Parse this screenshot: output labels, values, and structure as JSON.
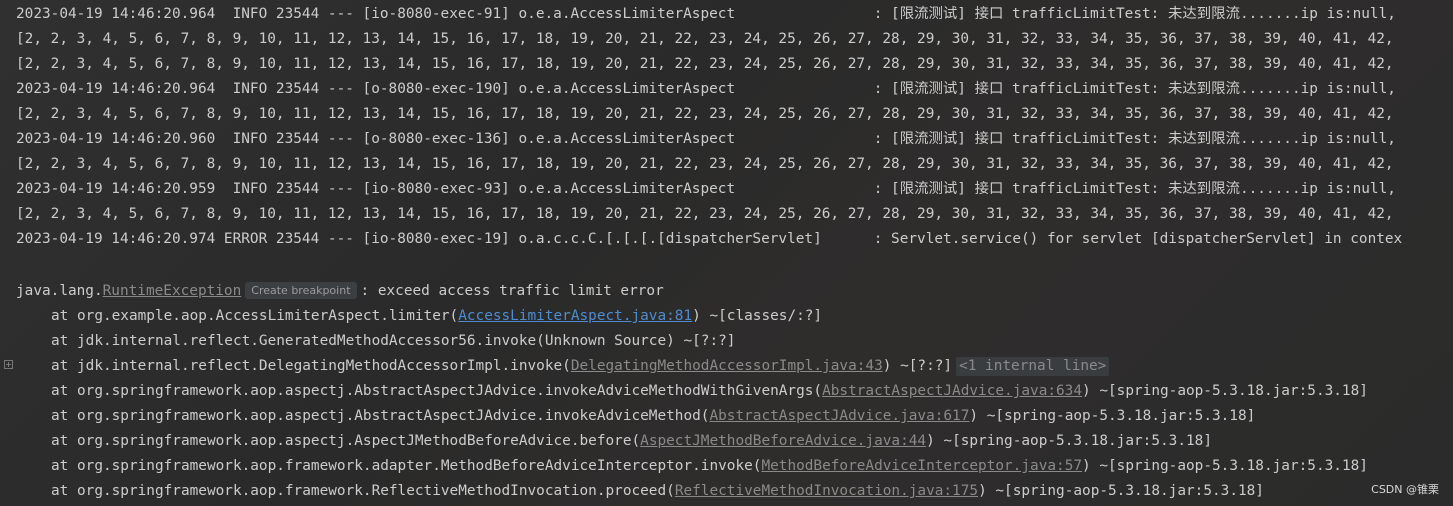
{
  "log_lines": [
    "2023-04-19 14:46:20.964  INFO 23544 --- [io-8080-exec-91] o.e.a.AccessLimiterAspect                : [限流测试] 接口 trafficLimitTest: 未达到限流.......ip is:null,",
    "[2, 2, 3, 4, 5, 6, 7, 8, 9, 10, 11, 12, 13, 14, 15, 16, 17, 18, 19, 20, 21, 22, 23, 24, 25, 26, 27, 28, 29, 30, 31, 32, 33, 34, 35, 36, 37, 38, 39, 40, 41, 42,",
    "[2, 2, 3, 4, 5, 6, 7, 8, 9, 10, 11, 12, 13, 14, 15, 16, 17, 18, 19, 20, 21, 22, 23, 24, 25, 26, 27, 28, 29, 30, 31, 32, 33, 34, 35, 36, 37, 38, 39, 40, 41, 42,",
    "2023-04-19 14:46:20.964  INFO 23544 --- [o-8080-exec-190] o.e.a.AccessLimiterAspect                : [限流测试] 接口 trafficLimitTest: 未达到限流.......ip is:null,",
    "[2, 2, 3, 4, 5, 6, 7, 8, 9, 10, 11, 12, 13, 14, 15, 16, 17, 18, 19, 20, 21, 22, 23, 24, 25, 26, 27, 28, 29, 30, 31, 32, 33, 34, 35, 36, 37, 38, 39, 40, 41, 42,",
    "2023-04-19 14:46:20.960  INFO 23544 --- [o-8080-exec-136] o.e.a.AccessLimiterAspect                : [限流测试] 接口 trafficLimitTest: 未达到限流.......ip is:null,",
    "[2, 2, 3, 4, 5, 6, 7, 8, 9, 10, 11, 12, 13, 14, 15, 16, 17, 18, 19, 20, 21, 22, 23, 24, 25, 26, 27, 28, 29, 30, 31, 32, 33, 34, 35, 36, 37, 38, 39, 40, 41, 42,",
    "2023-04-19 14:46:20.959  INFO 23544 --- [io-8080-exec-93] o.e.a.AccessLimiterAspect                : [限流测试] 接口 trafficLimitTest: 未达到限流.......ip is:null,",
    "[2, 2, 3, 4, 5, 6, 7, 8, 9, 10, 11, 12, 13, 14, 15, 16, 17, 18, 19, 20, 21, 22, 23, 24, 25, 26, 27, 28, 29, 30, 31, 32, 33, 34, 35, 36, 37, 38, 39, 40, 41, 42,",
    "2023-04-19 14:46:20.974 ERROR 23544 --- [io-8080-exec-19] o.a.c.c.C.[.[.[.[dispatcherServlet]      : Servlet.service() for servlet [dispatcherServlet] in contex"
  ],
  "exception": {
    "prefix": "java.lang.",
    "class_name": "RuntimeException",
    "hint": "Create breakpoint",
    "message": ": exceed access traffic limit error"
  },
  "stack": [
    {
      "pre": "at org.example.aop.AccessLimiterAspect.limiter(",
      "link": "AccessLimiterAspect.java:81",
      "post": ") ~[classes/:?]",
      "link_style": "active"
    },
    {
      "pre": "at jdk.internal.reflect.GeneratedMethodAccessor56.invoke(Unknown Source) ~[?:?]",
      "link": "",
      "post": "",
      "link_style": ""
    },
    {
      "pre": "at jdk.internal.reflect.DelegatingMethodAccessorImpl.invoke(",
      "link": "DelegatingMethodAccessorImpl.java:43",
      "post": ") ~[?:?]",
      "link_style": "muted",
      "folded": "<1 internal line>"
    },
    {
      "pre": "at org.springframework.aop.aspectj.AbstractAspectJAdvice.invokeAdviceMethodWithGivenArgs(",
      "link": "AbstractAspectJAdvice.java:634",
      "post": ") ~[spring-aop-5.3.18.jar:5.3.18]",
      "link_style": "muted"
    },
    {
      "pre": "at org.springframework.aop.aspectj.AbstractAspectJAdvice.invokeAdviceMethod(",
      "link": "AbstractAspectJAdvice.java:617",
      "post": ") ~[spring-aop-5.3.18.jar:5.3.18]",
      "link_style": "muted"
    },
    {
      "pre": "at org.springframework.aop.aspectj.AspectJMethodBeforeAdvice.before(",
      "link": "AspectJMethodBeforeAdvice.java:44",
      "post": ") ~[spring-aop-5.3.18.jar:5.3.18]",
      "link_style": "muted"
    },
    {
      "pre": "at org.springframework.aop.framework.adapter.MethodBeforeAdviceInterceptor.invoke(",
      "link": "MethodBeforeAdviceInterceptor.java:57",
      "post": ") ~[spring-aop-5.3.18.jar:5.3.18]",
      "link_style": "muted"
    },
    {
      "pre": "at org.springframework.aop.framework.ReflectiveMethodInvocation.proceed(",
      "link": "ReflectiveMethodInvocation.java:175",
      "post": ") ~[spring-aop-5.3.18.jar:5.3.18]",
      "link_style": "muted"
    }
  ],
  "gutter_icon": "fold-expand-icon",
  "gutter_glyph": "+",
  "watermark": "CSDN @锥栗"
}
